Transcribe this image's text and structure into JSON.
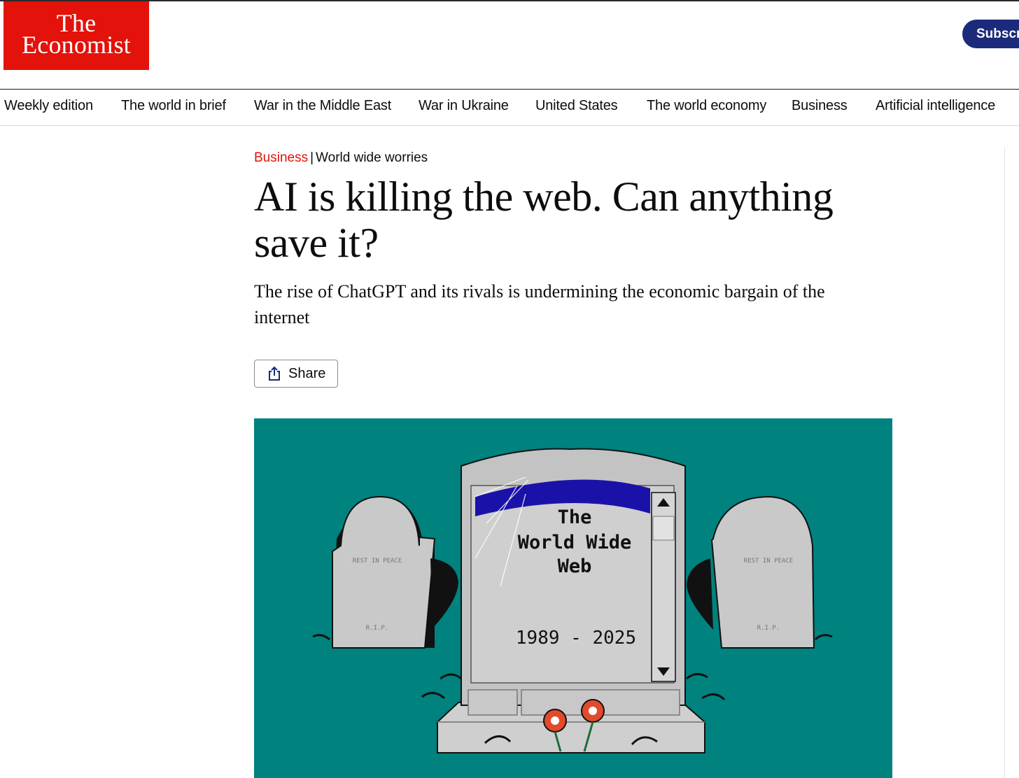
{
  "brand": {
    "logo_line1": "The",
    "logo_line2": "Economist",
    "logo_color": "#e3120b"
  },
  "header": {
    "subscribe_label": "Subscr"
  },
  "nav": {
    "items": [
      {
        "label": "Weekly edition"
      },
      {
        "label": "The world in brief"
      },
      {
        "label": "War in the Middle East"
      },
      {
        "label": "War in Ukraine"
      },
      {
        "label": "United States"
      },
      {
        "label": "The world economy"
      },
      {
        "label": "Business"
      },
      {
        "label": "Artificial intelligence"
      }
    ]
  },
  "article": {
    "section": "Business",
    "separator": "|",
    "rubric": "World wide worries",
    "headline": "AI is killing the web. Can anything save it?",
    "standfirst": "The rise of ChatGPT and its rivals is undermining the economic bargain of the internet",
    "share_label": "Share"
  },
  "illustration": {
    "background": "#00827f",
    "tombstone_line1": "The",
    "tombstone_line2": "World Wide",
    "tombstone_line3": "Web",
    "tombstone_dates": "1989 - 2025",
    "side_stone_text_top": "REST IN PEACE",
    "side_stone_text_bottom": "R.I.P."
  },
  "colors": {
    "accent_red": "#e3120b",
    "subscribe_navy": "#1b2a7a",
    "title_bar_blue": "#1a12a8"
  }
}
